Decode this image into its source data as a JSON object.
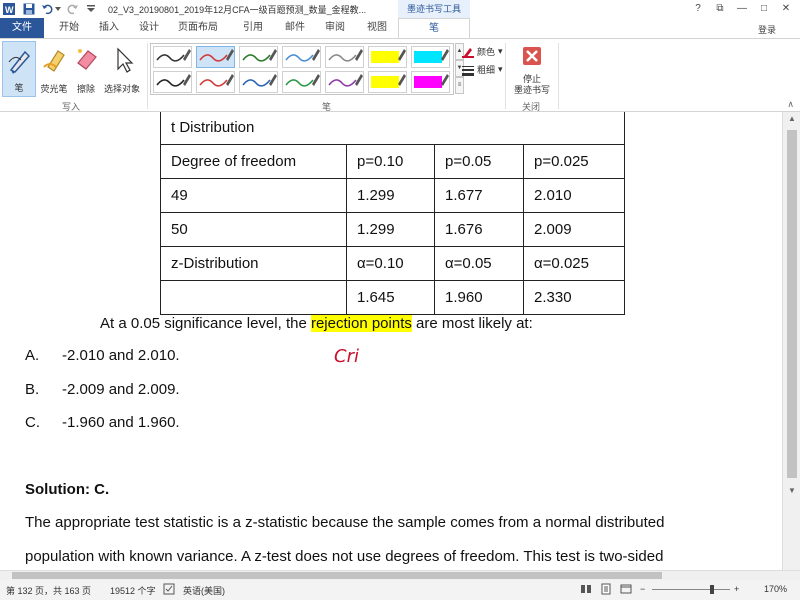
{
  "title_bar": {
    "document_title": "02_V3_20190801_2019年12月CFA一级百题预测_数量_金程教...",
    "context_tab_title": "墨迹书写工具",
    "help": "?",
    "restore": "⧉",
    "minimize": "—",
    "maximize": "□",
    "close": "✕"
  },
  "tabs": [
    "文件",
    "开始",
    "插入",
    "设计",
    "页面布局",
    "引用",
    "邮件",
    "审阅",
    "视图",
    "笔"
  ],
  "login_label": "登录",
  "ribbon": {
    "write_group": {
      "label": "写入",
      "buttons": [
        {
          "label": "笔"
        },
        {
          "label": "荧光笔"
        },
        {
          "label": "擦除"
        },
        {
          "label": "选择对象"
        }
      ]
    },
    "pens_group_label": "笔",
    "color_label": "颜色",
    "weight_label": "粗细",
    "close_group": {
      "label": "关闭",
      "stop_button_line1": "停止",
      "stop_button_line2": "墨迹书写"
    },
    "pen_colors": [
      "#333333",
      "#d23a3a",
      "#2a7a2a",
      "#4a8fd4",
      "#8a8a8a",
      "#ffff00",
      "#00e5ff",
      "#222222",
      "#d23a3a",
      "#2a64b4",
      "#2a9a4a",
      "#8e3aa8",
      "#ffff00",
      "#ff00ff"
    ]
  },
  "document": {
    "table": {
      "title": "t Distribution",
      "header": [
        "Degree of freedom",
        "p=0.10",
        "p=0.05",
        "p=0.025"
      ],
      "rows": [
        [
          "49",
          "1.299",
          "1.677",
          "2.010"
        ],
        [
          "50",
          "1.299",
          "1.676",
          "2.009"
        ],
        [
          "z-Distribution",
          "α=0.10",
          "α=0.05",
          "α=0.025"
        ],
        [
          "",
          "1.645",
          "1.960",
          "2.330"
        ]
      ]
    },
    "question_before": "At a 0.05 significance level, the ",
    "question_highlight": "rejection points",
    "question_after": " are most likely at:",
    "handwriting": "Cri",
    "options": [
      {
        "letter": "A.",
        "text": "-2.010 and 2.010."
      },
      {
        "letter": "B.",
        "text": "-2.009 and 2.009."
      },
      {
        "letter": "C.",
        "text": "-1.960 and 1.960."
      }
    ],
    "solution_label": "Solution: C.",
    "solution_line1": "The appropriate test statistic is a z-statistic because the sample comes from a normal distributed",
    "solution_line2": "population with known variance. A z-test does not use degrees of freedom. This test is two-sided"
  },
  "status_bar": {
    "page": "第 132 页，共 163 页",
    "words": "19512 个字",
    "language": "英语(美国)",
    "zoom_minus": "−",
    "zoom_plus": "+",
    "zoom": "170%"
  },
  "colors": {
    "brand_blue": "#2b579a",
    "highlight_yellow": "#ffff00",
    "ink_red": "#c8102e"
  }
}
